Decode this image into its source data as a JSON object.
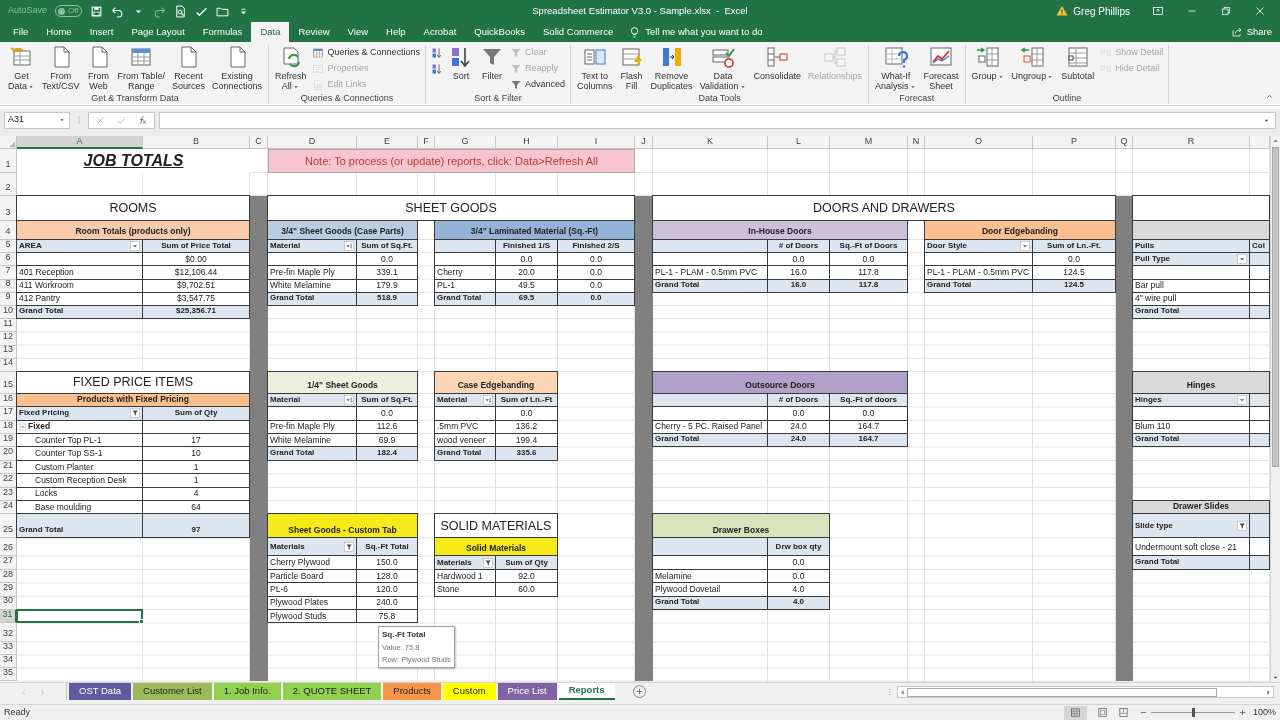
{
  "title_bar": {
    "autosave": {
      "label": "AutoSave",
      "state": "Off",
      "on": false
    },
    "title": "Spreadsheet Estimator V3.0 - Sample.xlsx  -  Excel",
    "user": "Greg Phillips"
  },
  "ribbon_tabs": [
    {
      "label": "File",
      "selected": false
    },
    {
      "label": "Home",
      "selected": false
    },
    {
      "label": "Insert",
      "selected": false
    },
    {
      "label": "Page Layout",
      "selected": false
    },
    {
      "label": "Formulas",
      "selected": false
    },
    {
      "label": "Data",
      "selected": true
    },
    {
      "label": "Review",
      "selected": false
    },
    {
      "label": "View",
      "selected": false
    },
    {
      "label": "Help",
      "selected": false
    },
    {
      "label": "Acrobat",
      "selected": false
    },
    {
      "label": "QuickBooks",
      "selected": false
    },
    {
      "label": "Solid Commerce",
      "selected": false
    }
  ],
  "tell_me": "Tell me what you want to do",
  "share": "Share",
  "ribbon_groups": [
    {
      "items": [
        {
          "kind": "large",
          "label": "Get\nData",
          "menu": true,
          "disabled": false
        },
        {
          "kind": "large",
          "label": "From\nText/CSV",
          "menu": false,
          "disabled": false
        },
        {
          "kind": "large",
          "label": "From\nWeb",
          "menu": false,
          "disabled": false
        },
        {
          "kind": "large",
          "label": "From Table/\nRange",
          "menu": false,
          "disabled": false
        },
        {
          "kind": "large",
          "label": "Recent\nSources",
          "menu": false,
          "disabled": false
        },
        {
          "kind": "large",
          "label": "Existing\nConnections",
          "menu": false,
          "disabled": false
        }
      ],
      "label": "Get & Transform Data"
    },
    {
      "items": [
        {
          "kind": "large",
          "label": "Refresh\nAll",
          "menu": true,
          "disabled": false
        },
        {
          "kind": "small",
          "label": "Queries & Connections",
          "menu": false,
          "disabled": false
        },
        {
          "kind": "small",
          "label": "Properties",
          "menu": false,
          "disabled": true
        },
        {
          "kind": "small",
          "label": "Edit Links",
          "menu": false,
          "disabled": true
        }
      ],
      "label": "Queries & Connections"
    },
    {
      "items": [
        {
          "kind": "icon",
          "menu": false,
          "disabled": false
        },
        {
          "kind": "icon",
          "menu": false,
          "disabled": false
        },
        {
          "kind": "large",
          "label": "Sort",
          "menu": false,
          "disabled": false
        },
        {
          "kind": "large",
          "label": "Filter",
          "menu": false,
          "disabled": false
        },
        {
          "kind": "small",
          "label": "Clear",
          "menu": false,
          "disabled": true
        },
        {
          "kind": "small",
          "label": "Reapply",
          "menu": false,
          "disabled": true
        },
        {
          "kind": "small",
          "label": "Advanced",
          "menu": false,
          "disabled": false
        }
      ],
      "label": "Sort & Filter"
    },
    {
      "items": [
        {
          "kind": "large",
          "label": "Text to\nColumns",
          "menu": false,
          "disabled": false
        },
        {
          "kind": "large",
          "label": "Flash\nFill",
          "menu": false,
          "disabled": false
        },
        {
          "kind": "large",
          "label": "Remove\nDuplicates",
          "menu": false,
          "disabled": false
        },
        {
          "kind": "large",
          "label": "Data\nValidation",
          "menu": true,
          "disabled": false
        },
        {
          "kind": "large",
          "label": "Consolidate",
          "menu": false,
          "disabled": false
        },
        {
          "kind": "large",
          "label": "Relationships",
          "menu": false,
          "disabled": true
        }
      ],
      "label": "Data Tools"
    },
    {
      "items": [
        {
          "kind": "large",
          "label": "What-If\nAnalysis",
          "menu": true,
          "disabled": false
        },
        {
          "kind": "large",
          "label": "Forecast\nSheet",
          "menu": false,
          "disabled": false
        }
      ],
      "label": "Forecast"
    },
    {
      "items": [
        {
          "kind": "large",
          "label": "Group",
          "menu": true,
          "disabled": false
        },
        {
          "kind": "large",
          "label": "Ungroup",
          "menu": true,
          "disabled": false
        },
        {
          "kind": "large",
          "label": "Subtotal",
          "menu": false,
          "disabled": false
        },
        {
          "kind": "small",
          "label": "Show Detail",
          "menu": false,
          "disabled": true
        },
        {
          "kind": "small",
          "label": "Hide Detail",
          "menu": false,
          "disabled": true
        }
      ],
      "label": "Outline"
    }
  ],
  "formula_bar": {
    "name_box": "A31"
  },
  "sheet": {
    "columns": [
      {
        "label": "A",
        "selected": true
      },
      {
        "label": "B",
        "selected": false
      },
      {
        "label": "C",
        "selected": false
      },
      {
        "label": "D",
        "selected": false
      },
      {
        "label": "E",
        "selected": false
      },
      {
        "label": "F",
        "selected": false
      },
      {
        "label": "G",
        "selected": false
      },
      {
        "label": "H",
        "selected": false
      },
      {
        "label": "I",
        "selected": false
      },
      {
        "label": "J",
        "selected": false
      },
      {
        "label": "K",
        "selected": false
      },
      {
        "label": "L",
        "selected": false
      },
      {
        "label": "M",
        "selected": false
      },
      {
        "label": "N",
        "selected": false
      },
      {
        "label": "O",
        "selected": false
      },
      {
        "label": "P",
        "selected": false
      },
      {
        "label": "Q",
        "selected": false
      },
      {
        "label": "R",
        "selected": false
      }
    ],
    "rows": [
      {
        "label": "1",
        "selected": false
      },
      {
        "label": "2",
        "selected": false
      },
      {
        "label": "3",
        "selected": false
      },
      {
        "label": "4",
        "selected": false
      },
      {
        "label": "5",
        "selected": false
      },
      {
        "label": "6",
        "selected": false
      },
      {
        "label": "7",
        "selected": false
      },
      {
        "label": "8",
        "selected": false
      },
      {
        "label": "9",
        "selected": false
      },
      {
        "label": "10",
        "selected": false
      },
      {
        "label": "11",
        "selected": false
      },
      {
        "label": "12",
        "selected": false
      },
      {
        "label": "13",
        "selected": false
      },
      {
        "label": "14",
        "selected": false
      },
      {
        "label": "15",
        "selected": false
      },
      {
        "label": "16",
        "selected": false
      },
      {
        "label": "17",
        "selected": false
      },
      {
        "label": "18",
        "selected": false
      },
      {
        "label": "19",
        "selected": false
      },
      {
        "label": "20",
        "selected": false
      },
      {
        "label": "21",
        "selected": false
      },
      {
        "label": "22",
        "selected": false
      },
      {
        "label": "23",
        "selected": false
      },
      {
        "label": "24",
        "selected": false
      },
      {
        "label": "25",
        "selected": false
      },
      {
        "label": "26",
        "selected": false
      },
      {
        "label": "27",
        "selected": false
      },
      {
        "label": "28",
        "selected": false
      },
      {
        "label": "29",
        "selected": false
      },
      {
        "label": "30",
        "selected": false
      },
      {
        "label": "31",
        "selected": true
      },
      {
        "label": "32",
        "selected": false
      },
      {
        "label": "33",
        "selected": false
      },
      {
        "label": "34",
        "selected": false
      },
      {
        "label": "35",
        "selected": false
      }
    ],
    "cells": [
      {
        "kind": "title",
        "text": "JOB TOTALS"
      },
      {
        "kind": "note",
        "text": "Note: To process (or update) reports, click: Data>Refresh All"
      },
      {
        "kind": "section",
        "text": "ROOMS"
      },
      {
        "kind": "section",
        "text": "SHEET GOODS"
      },
      {
        "kind": "section",
        "text": "DOORS AND DRAWERS"
      },
      {
        "kind": "section"
      },
      {
        "kind": "caption",
        "text": "Room Totals (products only)",
        "color": "#f8cbad"
      },
      {
        "kind": "caption",
        "text": "3/4\" Sheet Goods (Case Parts)",
        "color": "#b8cce4"
      },
      {
        "kind": "caption",
        "text": "3/4\" Laminated Material (Sq.-Ft)",
        "color": "#95b3d7"
      },
      {
        "kind": "caption",
        "text": "In-House Doors",
        "color": "#ccc0da"
      },
      {
        "kind": "caption",
        "text": "Door Edgebanding",
        "color": "#fac090"
      },
      {
        "kind": "caption",
        "color": "#d9d9d9"
      },
      {
        "kind": "head-dropdown",
        "text": "AREA"
      },
      {
        "kind": "head-num",
        "text": "Sum of Price Total"
      },
      {
        "kind": "head-sort",
        "text": "Material"
      },
      {
        "kind": "head-num",
        "text": "Sum of Sq.Ft."
      },
      {
        "kind": "head"
      },
      {
        "kind": "head-num",
        "text": "Finished 1/S"
      },
      {
        "kind": "head-num",
        "text": "Finished 2/S"
      },
      {
        "kind": "head"
      },
      {
        "kind": "head-num",
        "text": "# of Doors"
      },
      {
        "kind": "head-num",
        "text": "Sq.-Ft of Doors"
      },
      {
        "kind": "head-dropdown",
        "text": "Door Style"
      },
      {
        "kind": "head-num",
        "text": "Sum of Ln.-Ft."
      },
      {
        "kind": "head",
        "text": "Pulls"
      },
      {
        "kind": "head",
        "text": "Col"
      },
      {
        "kind": "cell"
      },
      {
        "kind": "num",
        "text": "$0.00"
      },
      {
        "kind": "cell"
      },
      {
        "kind": "num",
        "text": "0.0"
      },
      {
        "kind": "cell"
      },
      {
        "kind": "num",
        "text": "0.0"
      },
      {
        "kind": "num",
        "text": "0.0"
      },
      {
        "kind": "cell"
      },
      {
        "kind": "num",
        "text": "0.0"
      },
      {
        "kind": "num",
        "text": "0.0"
      },
      {
        "kind": "cell"
      },
      {
        "kind": "num",
        "text": "0.0"
      },
      {
        "kind": "head-dropdown",
        "text": "Pull Type"
      },
      {
        "kind": "head"
      },
      {
        "kind": "cell",
        "text": "401 Reception"
      },
      {
        "kind": "num",
        "text": "$12,106.44"
      },
      {
        "kind": "cell",
        "text": "Pre-fin Maple Ply"
      },
      {
        "kind": "num",
        "text": "339.1"
      },
      {
        "kind": "cell",
        "text": "Cherry"
      },
      {
        "kind": "num",
        "text": "20.0"
      },
      {
        "kind": "num",
        "text": "0.0"
      },
      {
        "kind": "cell",
        "text": "PL-1  - PLAM - 0.5mm PVC"
      },
      {
        "kind": "num",
        "text": "16.0"
      },
      {
        "kind": "num",
        "text": "117.8"
      },
      {
        "kind": "cell",
        "text": "PL-1  - PLAM - 0.5mm PVC"
      },
      {
        "kind": "num",
        "text": "124.5"
      },
      {
        "kind": "cell"
      },
      {
        "kind": "cell"
      },
      {
        "kind": "cell",
        "text": "411 Workroom"
      },
      {
        "kind": "num",
        "text": "$9,702.51"
      },
      {
        "kind": "cell",
        "text": "White Melamine"
      },
      {
        "kind": "num",
        "text": "179.9"
      },
      {
        "kind": "cell",
        "text": "PL-1"
      },
      {
        "kind": "num",
        "text": "49.5"
      },
      {
        "kind": "num",
        "text": "0.0"
      },
      {
        "kind": "total",
        "text": "Grand Total"
      },
      {
        "kind": "total-num",
        "text": "16.0"
      },
      {
        "kind": "total-num",
        "text": "117.8"
      },
      {
        "kind": "total",
        "text": "Grand Total"
      },
      {
        "kind": "total-num",
        "text": "124.5"
      },
      {
        "kind": "cell",
        "text": "Bar pull"
      },
      {
        "kind": "cell"
      },
      {
        "kind": "cell",
        "text": "412 Pantry"
      },
      {
        "kind": "num",
        "text": "$3,547.75"
      },
      {
        "kind": "total",
        "text": "Grand Total"
      },
      {
        "kind": "total-num",
        "text": "518.9"
      },
      {
        "kind": "total",
        "text": "Grand Total"
      },
      {
        "kind": "total-num",
        "text": "69.5"
      },
      {
        "kind": "total-num",
        "text": "0.0"
      },
      {
        "kind": "cell",
        "text": "4\" wire pull"
      },
      {
        "kind": "cell"
      },
      {
        "kind": "total",
        "text": "Grand Total"
      },
      {
        "kind": "total-num",
        "text": "$25,356.71"
      },
      {
        "kind": "total",
        "text": "Grand Total"
      },
      {
        "kind": "total"
      },
      {
        "kind": "section",
        "text": "FIXED PRICE ITEMS"
      },
      {
        "kind": "caption",
        "text": "1/4\" Sheet Goods",
        "color": "#ebf1de"
      },
      {
        "kind": "caption",
        "text": "Case Edgebanding",
        "color": "#fcd5b4"
      },
      {
        "kind": "caption",
        "text": "Outsource Doors",
        "color": "#b1a0c7"
      },
      {
        "kind": "caption",
        "text": "Hinges",
        "color": "#d9d9d9"
      },
      {
        "kind": "caption",
        "text": "Products with Fixed Pricing",
        "color": "#fabf8f"
      },
      {
        "kind": "head-sort",
        "text": "Material"
      },
      {
        "kind": "head-num",
        "text": "Sum of Sq.Ft."
      },
      {
        "kind": "head-sort",
        "text": "Material"
      },
      {
        "kind": "head-num",
        "text": "Sum of Ln.-Ft"
      },
      {
        "kind": "head"
      },
      {
        "kind": "head-num",
        "text": "# of Doors"
      },
      {
        "kind": "head-num",
        "text": "Sq.-Ft of doors"
      },
      {
        "kind": "head-dropdown",
        "text": "Hinges"
      },
      {
        "kind": "head"
      },
      {
        "kind": "head-filter",
        "text": "Fixed Pricing"
      },
      {
        "kind": "head-num",
        "text": "Sum of Qty"
      },
      {
        "kind": "cell"
      },
      {
        "kind": "num",
        "text": "0.0"
      },
      {
        "kind": "cell"
      },
      {
        "kind": "num",
        "text": "0.0"
      },
      {
        "kind": "cell"
      },
      {
        "kind": "num",
        "text": "0.0"
      },
      {
        "kind": "num",
        "text": "0.0"
      },
      {
        "kind": "cell"
      },
      {
        "kind": "cell"
      },
      {
        "kind": "group",
        "text": "Fixed",
        "expanded": true
      },
      {
        "kind": "cell"
      },
      {
        "kind": "cell",
        "text": "Pre-fin Maple Ply"
      },
      {
        "kind": "num",
        "text": "112.6"
      },
      {
        "kind": "cell",
        "text": ".5mm PVC"
      },
      {
        "kind": "num",
        "text": "136.2"
      },
      {
        "kind": "cell",
        "text": "Cherry - 5 PC. Raised Panel"
      },
      {
        "kind": "num",
        "text": "24.0"
      },
      {
        "kind": "num",
        "text": "164.7"
      },
      {
        "kind": "cell",
        "text": "Blum 110"
      },
      {
        "kind": "cell"
      },
      {
        "kind": "indent",
        "text": "Counter Top PL-1"
      },
      {
        "kind": "num",
        "text": "17"
      },
      {
        "kind": "cell",
        "text": "White Melamine"
      },
      {
        "kind": "num",
        "text": "69.9"
      },
      {
        "kind": "cell",
        "text": "wood veneer"
      },
      {
        "kind": "num",
        "text": "199.4"
      },
      {
        "kind": "total",
        "text": "Grand Total"
      },
      {
        "kind": "total-num",
        "text": "24.0"
      },
      {
        "kind": "total-num",
        "text": "164.7"
      },
      {
        "kind": "total",
        "text": "Grand Total"
      },
      {
        "kind": "total"
      },
      {
        "kind": "indent",
        "text": "Counter Top SS-1"
      },
      {
        "kind": "num",
        "text": "10"
      },
      {
        "kind": "total",
        "text": "Grand Total"
      },
      {
        "kind": "total-num",
        "text": "182.4"
      },
      {
        "kind": "total",
        "text": "Grand Total"
      },
      {
        "kind": "total-num",
        "text": "335.6"
      },
      {
        "kind": "indent",
        "text": "Custom Planter"
      },
      {
        "kind": "num",
        "text": "1"
      },
      {
        "kind": "indent",
        "text": "Custom Reception Desk"
      },
      {
        "kind": "num",
        "text": "1"
      },
      {
        "kind": "indent",
        "text": "Locks"
      },
      {
        "kind": "num",
        "text": "4"
      },
      {
        "kind": "indent",
        "text": "Base moulding"
      },
      {
        "kind": "num",
        "text": "64"
      },
      {
        "kind": "caption",
        "text": "Drawer Slides",
        "color": "#d9d9d9"
      },
      {
        "kind": "total",
        "text": "Grand Total"
      },
      {
        "kind": "total-num",
        "text": "97"
      },
      {
        "kind": "caption",
        "text": "Sheet Goods - Custom Tab",
        "color": "#f7ea1a"
      },
      {
        "kind": "section",
        "text": "SOLID MATERIALS"
      },
      {
        "kind": "caption",
        "text": "Drawer Boxes",
        "color": "#d8e4bc"
      },
      {
        "kind": "head-filter",
        "text": "Slide type"
      },
      {
        "kind": "head"
      },
      {
        "kind": "head-filter",
        "text": "Materials"
      },
      {
        "kind": "head-num",
        "text": "Sq.-Ft Total"
      },
      {
        "kind": "caption",
        "text": "Solid Materials",
        "color": "#f7ea1a"
      },
      {
        "kind": "head"
      },
      {
        "kind": "head-num",
        "text": "Drw box qty"
      },
      {
        "kind": "cell",
        "text": "Undermount soft close - 21"
      },
      {
        "kind": "cell"
      },
      {
        "kind": "cell",
        "text": "Cherry Plywood"
      },
      {
        "kind": "num",
        "text": "150.0"
      },
      {
        "kind": "head-filter",
        "text": "Materials"
      },
      {
        "kind": "head-num",
        "text": "Sum of Qty"
      },
      {
        "kind": "cell"
      },
      {
        "kind": "num",
        "text": "0.0"
      },
      {
        "kind": "total",
        "text": "Grand Total"
      },
      {
        "kind": "total"
      },
      {
        "kind": "cell",
        "text": "Particle Board"
      },
      {
        "kind": "num",
        "text": "128.0"
      },
      {
        "kind": "cell",
        "text": "Hardwood 1"
      },
      {
        "kind": "num",
        "text": "92.0"
      },
      {
        "kind": "cell",
        "text": "Melamine"
      },
      {
        "kind": "num",
        "text": "0.0"
      },
      {
        "kind": "cell",
        "text": "PL-6"
      },
      {
        "kind": "num",
        "text": "120.0"
      },
      {
        "kind": "cell",
        "text": "Stone"
      },
      {
        "kind": "num",
        "text": "60.0"
      },
      {
        "kind": "cell",
        "text": "Plywood Dovetail"
      },
      {
        "kind": "num",
        "text": "4.0"
      },
      {
        "kind": "cell",
        "text": "Plywood Plates"
      },
      {
        "kind": "num",
        "text": "240.0"
      },
      {
        "kind": "total",
        "text": "Grand Total"
      },
      {
        "kind": "total-num",
        "text": "4.0"
      },
      {
        "kind": "cell",
        "text": "Plywood Studs"
      },
      {
        "kind": "num",
        "text": "75.8"
      }
    ],
    "tooltip": {
      "title": "Sq.-Ft Total",
      "lines": [
        "Value: 75.8",
        "Row: Plywood Studs"
      ]
    }
  },
  "sheet_tabs": [
    {
      "label": "OST Data",
      "color": "#5f5b9e",
      "selected": false
    },
    {
      "label": "Customer List",
      "color": "#9bbb59",
      "selected": false
    },
    {
      "label": "1. Job Info.",
      "color": "#92d050",
      "selected": false
    },
    {
      "label": "2. QUOTE SHEET",
      "color": "#92d050",
      "selected": false
    },
    {
      "label": "Products",
      "color": "#f79646",
      "selected": false
    },
    {
      "label": "Custom",
      "color": "#ffff00",
      "selected": false
    },
    {
      "label": "Price List",
      "color": "#8064a2",
      "selected": false
    },
    {
      "label": "Reports",
      "selected": true
    }
  ],
  "status_bar": {
    "text": "Ready",
    "zoom": {
      "label": "100%",
      "level": 0.5
    }
  }
}
